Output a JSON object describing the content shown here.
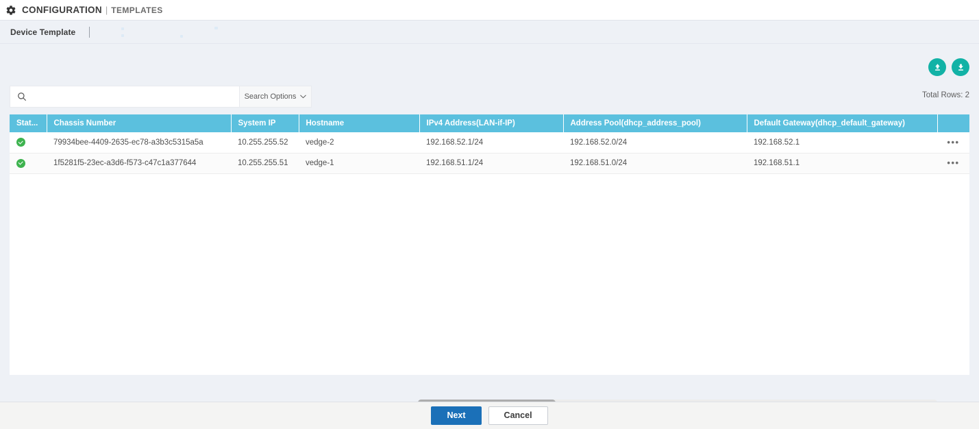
{
  "topbar": {
    "gear_icon": "gear-icon",
    "section": "CONFIGURATION",
    "separator": "|",
    "subsection": "TEMPLATES"
  },
  "subheader": {
    "title": "Device Template",
    "divider": "|"
  },
  "toolbar": {
    "upload_icon": "upload-icon",
    "download_icon": "download-icon",
    "total_rows_label": "Total Rows: 2"
  },
  "search": {
    "icon": "search-icon",
    "value": "",
    "placeholder": "",
    "options_label": "Search Options",
    "chevron_icon": "chevron-down-icon"
  },
  "table": {
    "columns": [
      "Stat...",
      "Chassis Number",
      "System IP",
      "Hostname",
      "IPv4 Address(LAN-if-IP)",
      "Address Pool(dhcp_address_pool)",
      "Default Gateway(dhcp_default_gateway)",
      ""
    ],
    "rows": [
      {
        "status": "ok",
        "chassis_number": "79934bee-4409-2635-ec78-a3b3c5315a5a",
        "system_ip": "10.255.255.52",
        "hostname": "vedge-2",
        "ipv4_address": "192.168.52.1/24",
        "address_pool": "192.168.52.0/24",
        "default_gateway": "192.168.52.1",
        "actions": "•••"
      },
      {
        "status": "ok",
        "chassis_number": "1f5281f5-23ec-a3d6-f573-c47c1a377644",
        "system_ip": "10.255.255.51",
        "hostname": "vedge-1",
        "ipv4_address": "192.168.51.1/24",
        "address_pool": "192.168.51.0/24",
        "default_gateway": "192.168.51.1",
        "actions": "•••"
      }
    ]
  },
  "footer": {
    "next_label": "Next",
    "cancel_label": "Cancel"
  },
  "colors": {
    "table_header": "#5bc0de",
    "status_ok": "#3eb34f",
    "accent_teal": "#12b2a6",
    "primary_button": "#1b70b8",
    "page_background": "#eef1f6"
  }
}
